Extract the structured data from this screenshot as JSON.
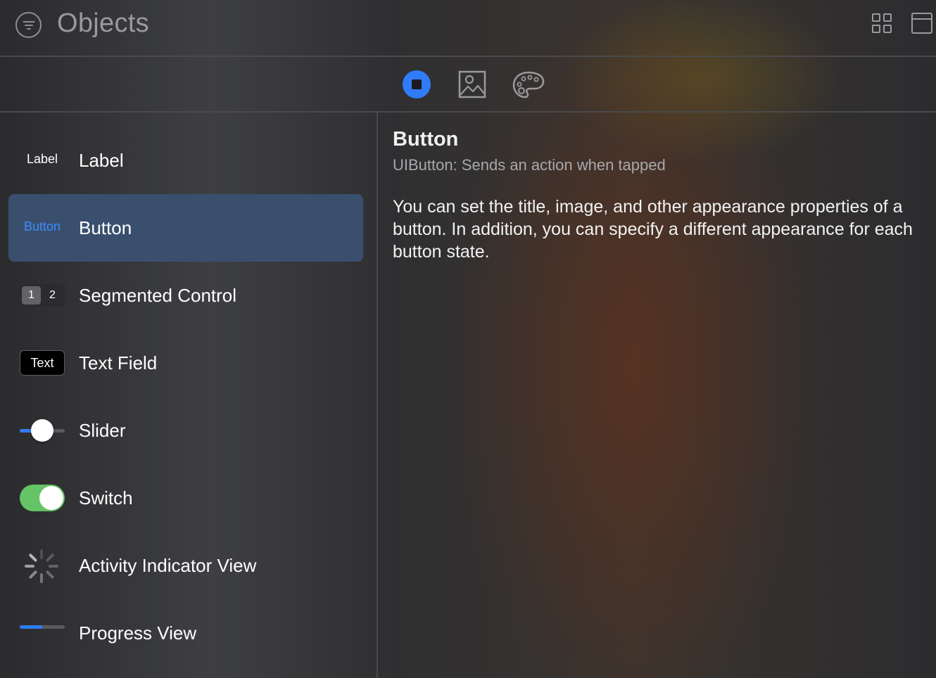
{
  "header": {
    "title": "Objects",
    "filter_icon": "filter-circle-icon",
    "grid_icon": "grid-view-icon",
    "window_icon": "window-icon"
  },
  "tabs": [
    {
      "icon": "objects-icon",
      "selected": true
    },
    {
      "icon": "media-image-icon",
      "selected": false
    },
    {
      "icon": "color-palette-icon",
      "selected": false
    }
  ],
  "accent_color": "#2f7cf6",
  "switch_color": "#65c466",
  "selected_row_color": "#3a4f6e",
  "library": {
    "items": [
      {
        "name": "Label",
        "thumb_text": "Label"
      },
      {
        "name": "Button",
        "thumb_text": "Button",
        "selected": true
      },
      {
        "name": "Segmented Control",
        "seg1": "1",
        "seg2": "2"
      },
      {
        "name": "Text Field",
        "thumb_text": "Text"
      },
      {
        "name": "Slider",
        "slider_value": 0.5
      },
      {
        "name": "Switch",
        "switch_on": true
      },
      {
        "name": "Activity Indicator View"
      },
      {
        "name": "Progress View",
        "progress_value": 0.5
      }
    ]
  },
  "detail": {
    "title": "Button",
    "subtitle": "UIButton: Sends an action when tapped",
    "body": "You can set the title, image, and other appearance properties of a button. In addition, you can specify a different appearance for each button state."
  }
}
